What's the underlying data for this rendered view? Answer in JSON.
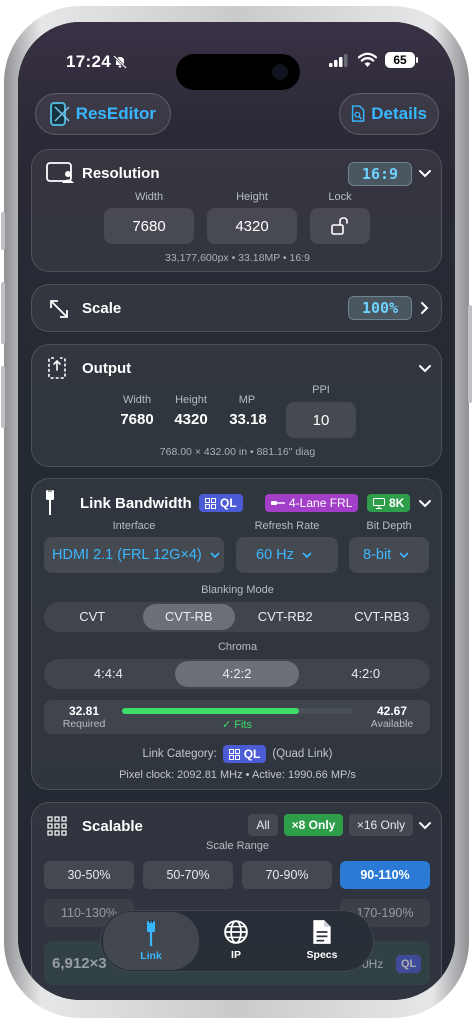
{
  "status": {
    "time": "17:24",
    "battery": "65"
  },
  "header": {
    "app_name": "ResEditor",
    "details_label": "Details"
  },
  "resolution": {
    "title": "Resolution",
    "ratio_badge": "16:9",
    "width_label": "Width",
    "height_label": "Height",
    "lock_label": "Lock",
    "width": "7680",
    "height": "4320",
    "summary": "33,177,600px • 33.18MP • 16:9"
  },
  "scale": {
    "title": "Scale",
    "value": "100%"
  },
  "output": {
    "title": "Output",
    "width_label": "Width",
    "height_label": "Height",
    "mp_label": "MP",
    "ppi_label": "PPI",
    "width": "7680",
    "height": "4320",
    "mp": "33.18",
    "ppi": "10",
    "summary": "768.00 × 432.00 in • 881.16\" diag"
  },
  "link": {
    "title": "Link Bandwidth",
    "tag_ql": "QL",
    "tag_frl": "4-Lane FRL",
    "tag_8k": "8K",
    "interface_label": "Interface",
    "refresh_label": "Refresh Rate",
    "depth_label": "Bit Depth",
    "interface": "HDMI 2.1 (FRL 12G×4)",
    "refresh": "60 Hz",
    "depth": "8-bit",
    "blanking_label": "Blanking Mode",
    "blanking": [
      "CVT",
      "CVT-RB",
      "CVT-RB2",
      "CVT-RB3"
    ],
    "chroma_label": "Chroma",
    "chroma": [
      "4:4:4",
      "4:2:2",
      "4:2:0"
    ],
    "required": "32.81",
    "required_label": "Required",
    "available": "42.67",
    "available_label": "Available",
    "fits": "✓ Fits",
    "usage_fraction": 0.769,
    "category_label": "Link Category:",
    "category_tag": "QL",
    "category_note": "(Quad Link)",
    "pixel_clock": "Pixel clock: 2092.81 MHz • Active: 1990.66 MP/s"
  },
  "scalable": {
    "title": "Scalable",
    "filters": [
      "All",
      "×8 Only",
      "×16 Only"
    ],
    "range_label": "Scale Range",
    "ranges_row1": [
      "30-50%",
      "50-70%",
      "70-90%",
      "90-110%"
    ],
    "ranges_row2": [
      "110-130%",
      "170-190%"
    ],
    "peek_value": "6,912×3",
    "peek_tag": "QL",
    "peek_hz": "0Hz"
  },
  "tabs": [
    {
      "label": "Link"
    },
    {
      "label": "IP"
    },
    {
      "label": "Specs"
    }
  ],
  "colors": {
    "accent": "#38b6ff",
    "ok_green": "#3ddc6b",
    "selected_chip": "#2b7bd6",
    "tag_ql": "#4c5bd6",
    "tag_frl": "#a23ec7",
    "tag_8k": "#2f9e4a"
  }
}
